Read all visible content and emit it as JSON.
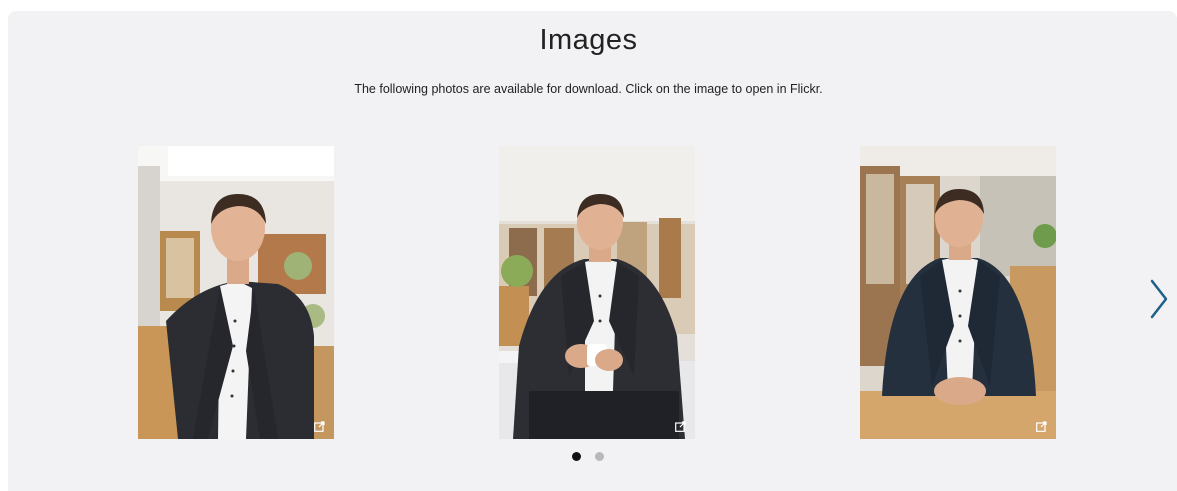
{
  "section": {
    "title": "Images",
    "description": "The following photos are available for download. Click on the image to open in Flickr."
  },
  "gallery": {
    "photos": [
      {
        "pose": "standing-hands-in-pockets",
        "link_icon": "external-link-icon"
      },
      {
        "pose": "leaning-holding-cup",
        "link_icon": "external-link-icon"
      },
      {
        "pose": "seated-hands-clasped",
        "link_icon": "external-link-icon"
      }
    ],
    "next_icon": "chevron-right-icon",
    "page_count": 2,
    "current_page": 1
  },
  "colors": {
    "panel_bg": "#f2f2f4",
    "arrow": "#1f5f8b",
    "dot_active": "#111111",
    "dot_inactive": "#b8b8bc"
  }
}
